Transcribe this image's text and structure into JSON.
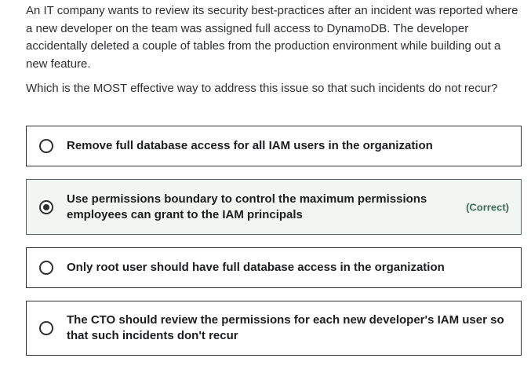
{
  "question": {
    "paragraph1": "An IT company wants to review its security best-practices after an incident was reported where a new developer on the team was assigned full access to DynamoDB. The developer accidentally deleted a couple of tables from the production environment while building out a new feature.",
    "paragraph2": "Which is the MOST effective way to address this issue so that such incidents do not recur?"
  },
  "options": [
    {
      "text": "Remove full database access for all IAM users in the organization",
      "selected": false
    },
    {
      "text": "Use permissions boundary to control the maximum permissions employees can grant to the IAM principals",
      "selected": true,
      "tag": "(Correct)"
    },
    {
      "text": "Only root user should have full database access in the organization",
      "selected": false
    },
    {
      "text": "The CTO should review the permissions for each new developer's IAM user so that such incidents don't recur",
      "selected": false
    }
  ],
  "colors": {
    "text": "#1c1d1f",
    "border": "#2d2f31",
    "correct_background": "#f2f6f3",
    "correct_tag": "#3d6b5a"
  }
}
